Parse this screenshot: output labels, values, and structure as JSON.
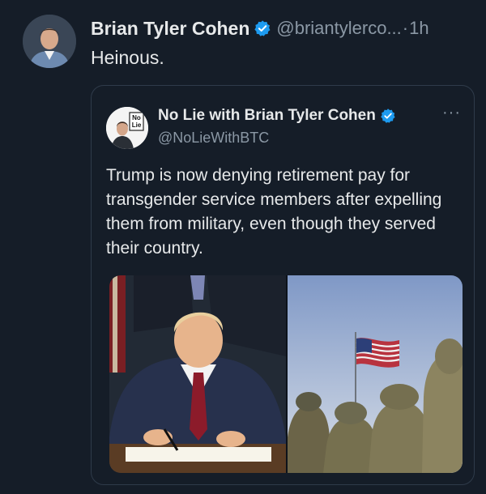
{
  "post": {
    "author_name": "Brian Tyler Cohen",
    "author_handle": "@briantylerco...",
    "separator": "·",
    "time": "1h",
    "text": "Heinous."
  },
  "quoted_post": {
    "author_name": "No Lie with Brian Tyler Cohen",
    "author_handle": "@NoLieWithBTC",
    "avatar_logo_text": "No Lie",
    "more_label": "···",
    "text": "Trump is now denying retirement pay for transgender service members after expelling them from military, even though they served their country."
  },
  "colors": {
    "background": "#151d28",
    "text_primary": "#e7e9ea",
    "text_secondary": "#8b98a5",
    "verified_blue": "#1d9bf0",
    "card_border": "#2f3b4a"
  },
  "icons": [
    "verified-badge-icon",
    "more-options-icon"
  ]
}
